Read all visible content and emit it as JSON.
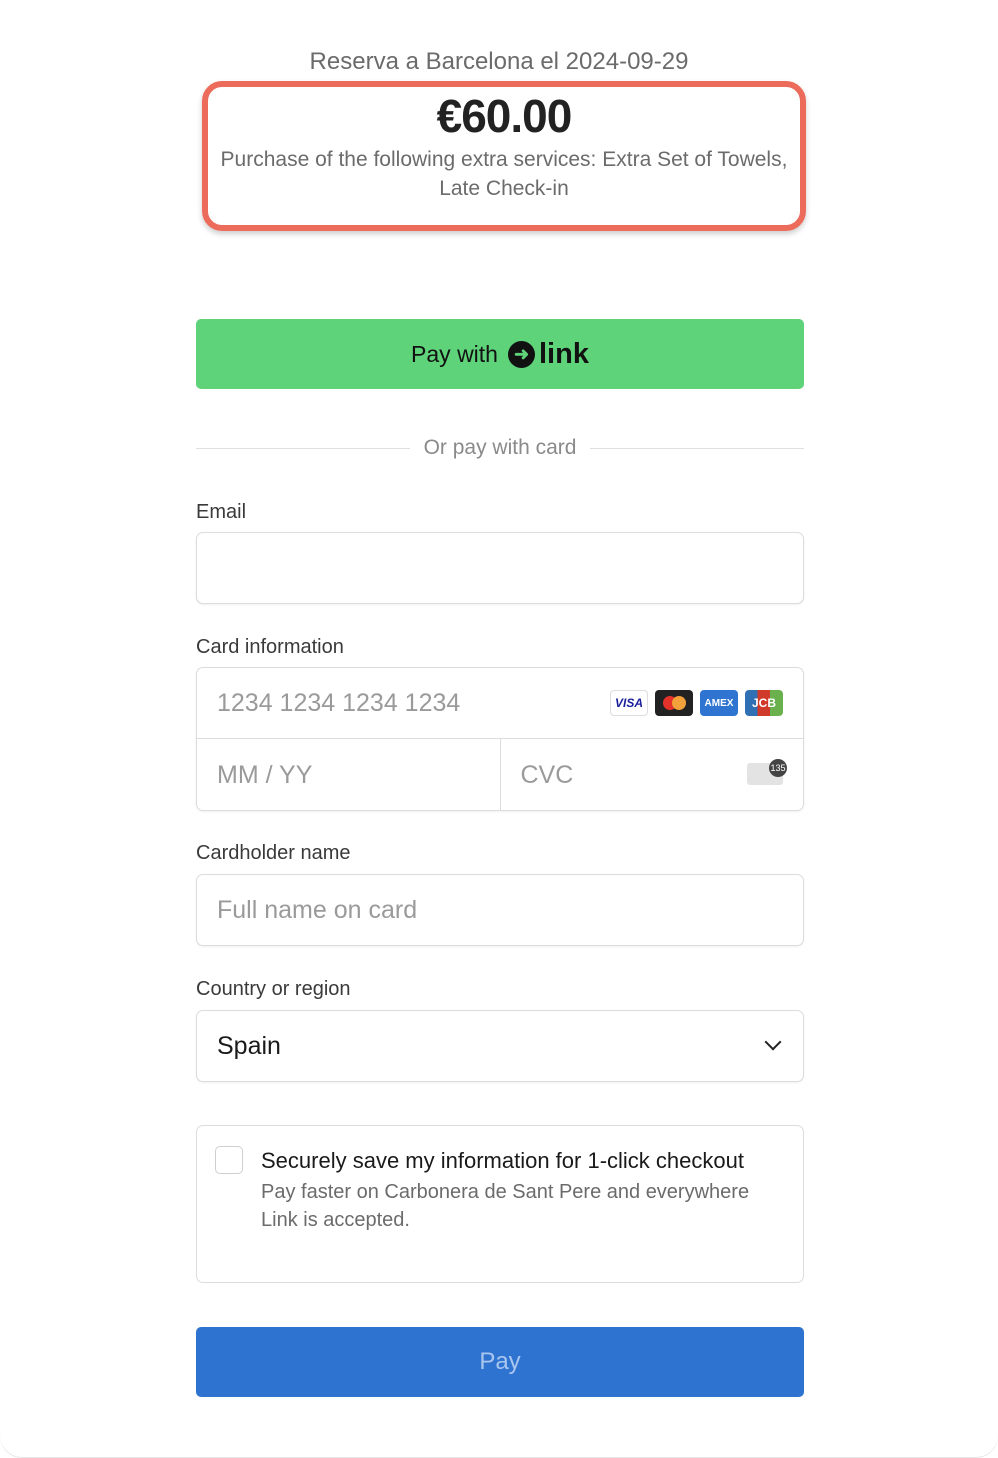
{
  "header": {
    "title": "Reserva a Barcelona el 2024-09-29",
    "amount": "€60.00",
    "description": "Purchase of the following extra services: Extra Set of Towels, Late Check-in",
    "highlight_color": "#EC6B5A"
  },
  "link_button": {
    "prefix": "Pay with",
    "logo": "link",
    "color": "#5fd37a"
  },
  "divider": {
    "text": "Or pay with card"
  },
  "email": {
    "label": "Email",
    "value": "",
    "placeholder": ""
  },
  "card": {
    "label": "Card information",
    "number_placeholder": "1234 1234 1234 1234",
    "expiry_placeholder": "MM / YY",
    "cvc_placeholder": "CVC",
    "cvc_hint": "135",
    "brands": [
      "VISA",
      "mastercard",
      "AMEX",
      "JCB"
    ]
  },
  "cardholder": {
    "label": "Cardholder name",
    "placeholder": "Full name on card"
  },
  "country": {
    "label": "Country or region",
    "value": "Spain"
  },
  "save": {
    "checked": false,
    "title": "Securely save my information for 1-click checkout",
    "subtitle": "Pay faster on Carbonera de Sant Pere and everywhere Link is accepted."
  },
  "pay_button": {
    "label": "Pay",
    "color": "#2f73d0"
  }
}
